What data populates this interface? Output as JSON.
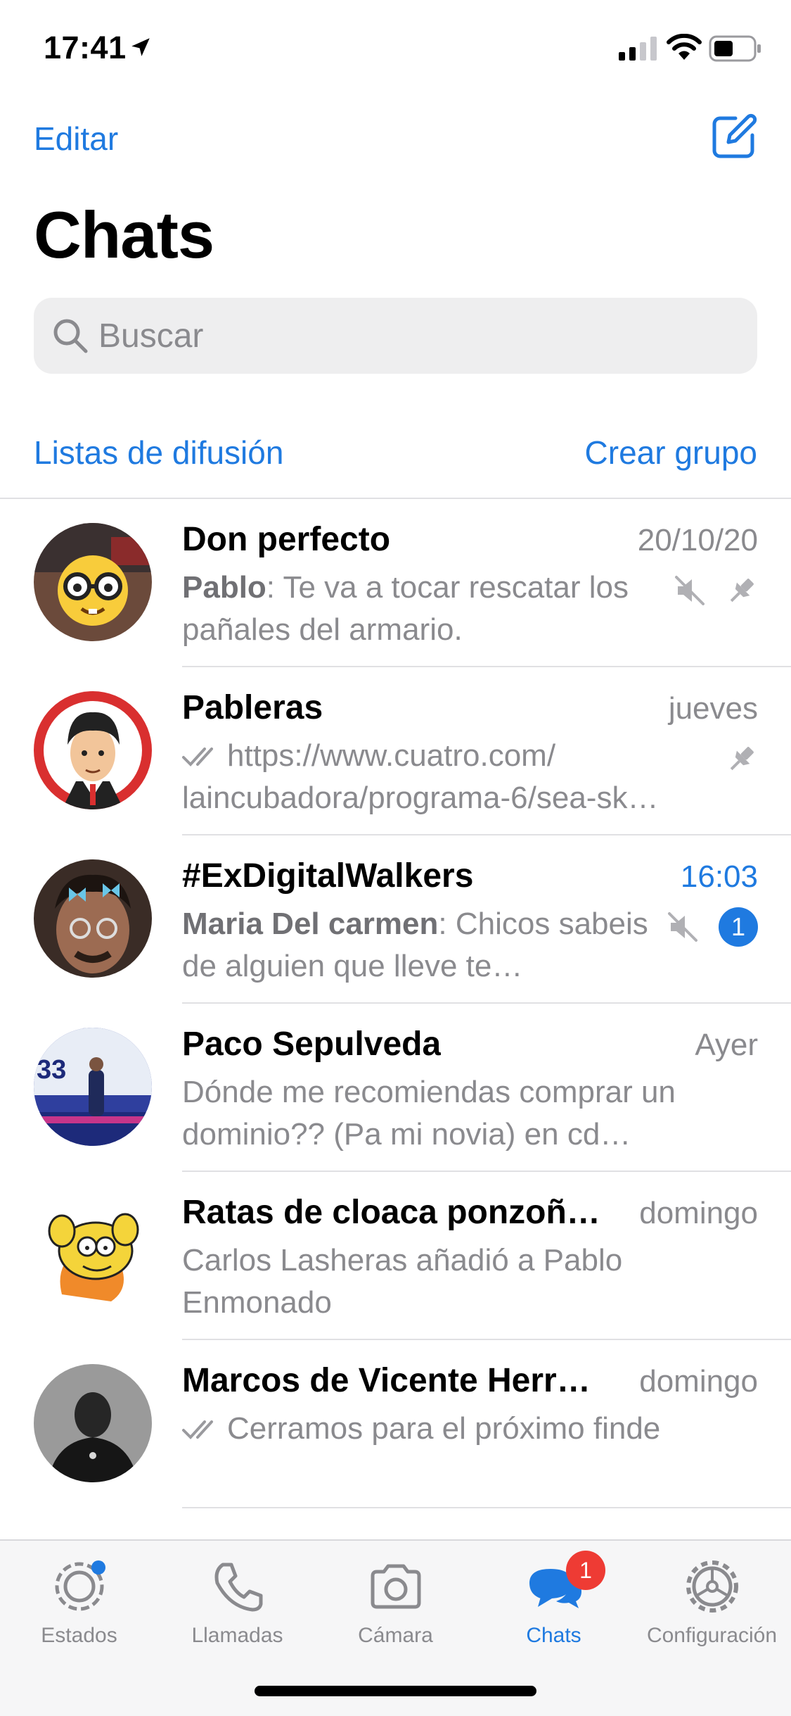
{
  "status_bar": {
    "time": "17:41"
  },
  "header": {
    "edit_label": "Editar",
    "title": "Chats"
  },
  "search": {
    "placeholder": "Buscar"
  },
  "links": {
    "broadcast": "Listas de difusión",
    "new_group": "Crear grupo"
  },
  "chats": [
    {
      "name": "Don perfecto",
      "time": "20/10/20",
      "sender": "Pablo",
      "message": "Te va a tocar rescatar los pañales del armario.",
      "muted": true,
      "pinned": true
    },
    {
      "name": "Pableras",
      "time": "jueves",
      "message": "https://www.cuatro.com/ laincubadora/programa-6/sea-sk…",
      "read_ticks": true,
      "pinned": true
    },
    {
      "name": "#ExDigitalWalkers",
      "time": "16:03",
      "sender": "Maria Del carmen",
      "message": "Chicos sabeis de alguien que lleve te…",
      "muted": true,
      "unread_count": "1"
    },
    {
      "name": "Paco Sepulveda",
      "time": "Ayer",
      "message": "Dónde me recomiendas comprar un dominio?? (Pa mi novia) en cd…"
    },
    {
      "name": "Ratas de cloaca ponzoñ…",
      "time": "domingo",
      "message": "Carlos Lasheras añadió a Pablo Enmonado"
    },
    {
      "name": "Marcos de Vicente Herr…",
      "time": "domingo",
      "message": "Cerramos para el próximo finde",
      "read_ticks": true
    }
  ],
  "tabs": [
    {
      "label": "Estados"
    },
    {
      "label": "Llamadas"
    },
    {
      "label": "Cámara"
    },
    {
      "label": "Chats",
      "badge": "1",
      "active": true
    },
    {
      "label": "Configuración"
    }
  ],
  "colors": {
    "accent": "#1f7ae0",
    "badge": "#ee3b34",
    "secondary_text": "#8a8a8e"
  }
}
